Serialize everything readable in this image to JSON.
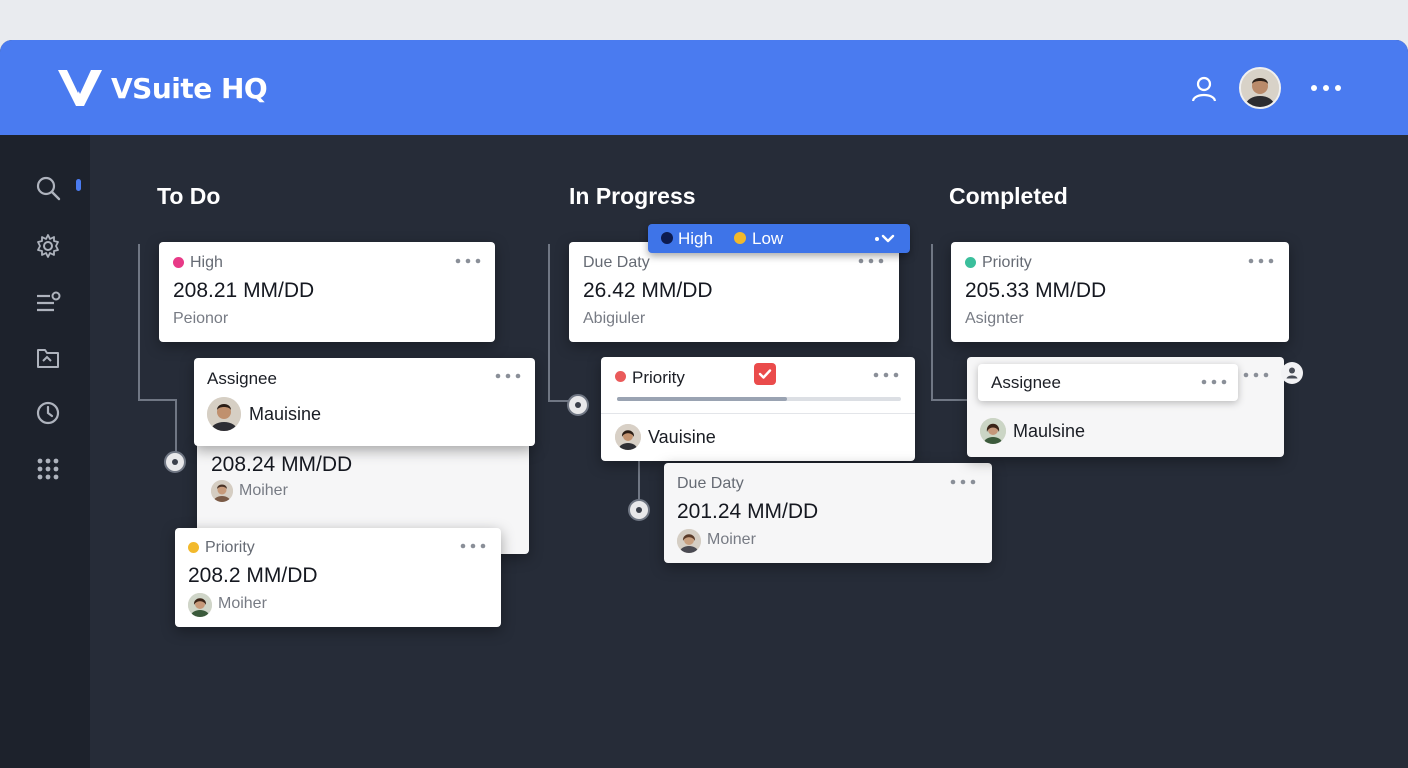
{
  "app": {
    "title": "VSuite HQ"
  },
  "icons": {
    "header": [
      "user-icon",
      "avatar",
      "more-icon"
    ],
    "sidebar": [
      "search-icon",
      "settings-icon",
      "list-filter-icon",
      "folder-icon",
      "clock-icon",
      "grid-icon"
    ]
  },
  "colors": {
    "header": "#4a7bf0",
    "sidebar": "#1d222c",
    "board": "#262c38",
    "high": "#e83a87",
    "red": "#ea5a5a",
    "yellow": "#f2b92c",
    "teal": "#3bbf9c",
    "navy": "#0d1b4f"
  },
  "filter": {
    "options": [
      "High",
      "Low"
    ]
  },
  "columns": [
    {
      "title": "To Do",
      "cards": [
        {
          "label": "High",
          "value": "208.21 MM/DD",
          "sub": "Peionor"
        },
        {
          "title": "Assignee",
          "name": "Mauisine"
        },
        {
          "value": "208.24 MM/DD",
          "name": "Moiher"
        },
        {
          "label": "Priority",
          "value": "208.2 MM/DD",
          "name": "Moiher"
        }
      ]
    },
    {
      "title": "In Progress",
      "cards": [
        {
          "label": "Due Daty",
          "value": "26.42 MM/DD",
          "sub": "Abigiuler"
        },
        {
          "label": "Priority",
          "progress": 0.6,
          "checked": true,
          "name": "Vauisine"
        },
        {
          "label": "Due Daty",
          "value": "201.24 MM/DD",
          "name": "Moiner"
        }
      ]
    },
    {
      "title": "Completed",
      "cards": [
        {
          "label": "Priority",
          "value": "205.33 MM/DD",
          "sub": "Asignter"
        },
        {
          "title": "Assignee",
          "name": "Maulsine"
        }
      ]
    }
  ]
}
